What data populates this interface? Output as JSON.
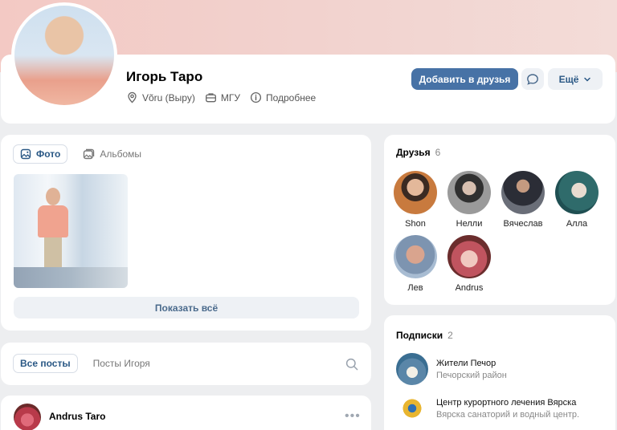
{
  "profile": {
    "name": "Игорь Таро",
    "location": "Võru (Выру)",
    "university": "МГУ",
    "details_link": "Подробнее",
    "add_friend_label": "Добавить в друзья",
    "more_label": "Ещё"
  },
  "photos": {
    "tabs": [
      {
        "label": "Фото",
        "icon": "image-icon",
        "active": true
      },
      {
        "label": "Альбомы",
        "icon": "albums-icon",
        "active": false
      }
    ],
    "show_all_label": "Показать всё"
  },
  "posts": {
    "tabs": [
      {
        "label": "Все посты",
        "active": true
      },
      {
        "label": "Посты Игоря",
        "active": false
      }
    ],
    "first_post_author": "Andrus Taro"
  },
  "friends": {
    "title": "Друзья",
    "count": "6",
    "items": [
      {
        "name": "Shon",
        "color": "#7a5a46"
      },
      {
        "name": "Нелли",
        "color": "#9a9a9a"
      },
      {
        "name": "Вячеслав",
        "color": "#3b3f4a"
      },
      {
        "name": "Алла",
        "color": "#2f6b6b"
      },
      {
        "name": "Лев",
        "color": "#8aa3c0"
      },
      {
        "name": "Andrus",
        "color": "#c0545f"
      }
    ]
  },
  "subscriptions": {
    "title": "Подписки",
    "count": "2",
    "items": [
      {
        "title": "Жители Печор",
        "subtitle": "Печорский район",
        "color": "#5a86a8"
      },
      {
        "title": "Центр курортного лечения Вярска",
        "subtitle": "Вярска санаторий и водный центр.",
        "color": "#e8b530"
      }
    ]
  },
  "colors": {
    "accent": "#4772a6",
    "link": "#2a5885",
    "background": "#edeef0"
  }
}
